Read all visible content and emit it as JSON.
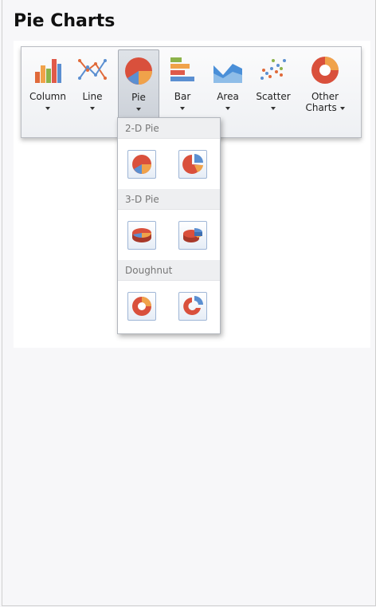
{
  "page": {
    "title": "Pie Charts"
  },
  "ribbon": {
    "buttons": [
      {
        "id": "column",
        "label": "Column",
        "icon": "column-chart-icon"
      },
      {
        "id": "line",
        "label": "Line",
        "icon": "line-chart-icon"
      },
      {
        "id": "pie",
        "label": "Pie",
        "icon": "pie-chart-icon",
        "state": "open"
      },
      {
        "id": "bar",
        "label": "Bar",
        "icon": "bar-chart-icon"
      },
      {
        "id": "area",
        "label": "Area",
        "icon": "area-chart-icon"
      },
      {
        "id": "scatter",
        "label": "Scatter",
        "icon": "scatter-chart-icon"
      },
      {
        "id": "other",
        "label_line1": "Other",
        "label_line2": "Charts",
        "icon": "doughnut-chart-icon"
      }
    ]
  },
  "pie_dropdown": {
    "sections": [
      {
        "header": "2-D Pie",
        "items": [
          "pie-icon",
          "exploded-pie-icon"
        ]
      },
      {
        "header": "3-D Pie",
        "items": [
          "pie-3d-icon",
          "exploded-pie-3d-icon"
        ]
      },
      {
        "header": "Doughnut",
        "items": [
          "doughnut-icon",
          "exploded-doughnut-icon"
        ]
      }
    ]
  },
  "colors": {
    "pie_red": "#d9503c",
    "pie_orange": "#f0a24a",
    "pie_blue": "#5b8fd1",
    "accent_border": "#9fb6d6"
  }
}
